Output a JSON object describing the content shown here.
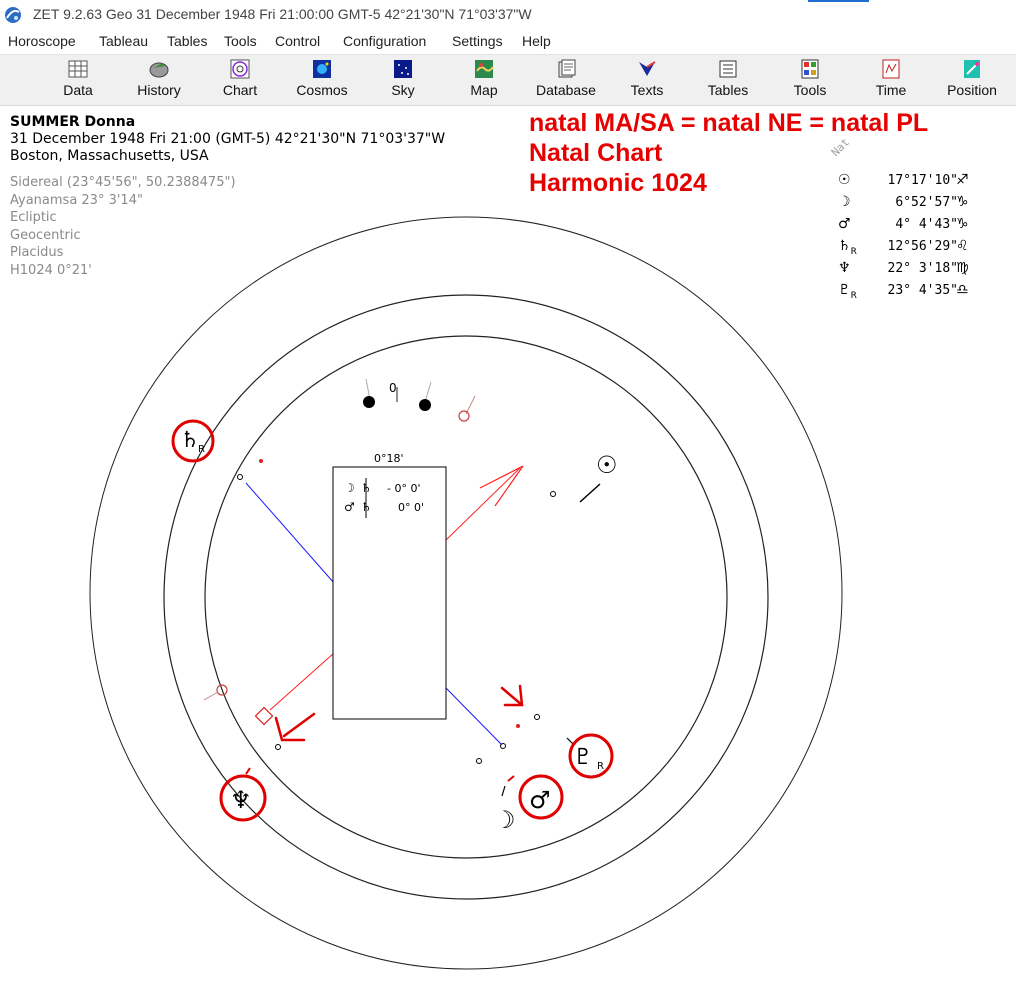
{
  "window": {
    "title": "ZET 9.2.63 Geo   31 December 1948  Fri  21:00:00 GMT-5 42°21'30\"N  71°03'37\"W"
  },
  "menu": [
    "Horoscope",
    "Tableau",
    "Tables",
    "Tools",
    "Control",
    "Configuration",
    "Settings",
    "Help"
  ],
  "toolbar": [
    {
      "label": "Data",
      "icon": "data-grid-icon"
    },
    {
      "label": "History",
      "icon": "history-icon"
    },
    {
      "label": "Chart",
      "icon": "chart-wheel-icon"
    },
    {
      "label": "Cosmos",
      "icon": "cosmos-icon"
    },
    {
      "label": "Sky",
      "icon": "sky-stars-icon"
    },
    {
      "label": "Map",
      "icon": "map-icon"
    },
    {
      "label": "Database",
      "icon": "database-icon"
    },
    {
      "label": "Texts",
      "icon": "texts-icon"
    },
    {
      "label": "Tables",
      "icon": "tables-icon"
    },
    {
      "label": "Tools",
      "icon": "tools-icon"
    },
    {
      "label": "Time",
      "icon": "time-icon"
    },
    {
      "label": "Position",
      "icon": "position-icon"
    }
  ],
  "person": {
    "name": "SUMMER Donna",
    "datetime": "31 December 1948  Fri  21:00 (GMT-5) 42°21'30\"N  71°03'37\"W",
    "place": "Boston, Massachusetts, USA"
  },
  "settings": [
    "Sidereal (23°45'56\", 50.2388475\")",
    "Ayanamsa 23° 3'14\"",
    "Ecliptic",
    "Geocentric",
    "Placidus",
    "H1024   0°21'"
  ],
  "notes": [
    "natal MA/SA = natal NE = natal PL",
    "Natal Chart",
    "Harmonic 1024"
  ],
  "positions": {
    "header": "Nat",
    "rows": [
      {
        "glyph": "☉",
        "retro": "",
        "value": "17°17'10\"",
        "sign": "♐"
      },
      {
        "glyph": "☽",
        "retro": "",
        "value": "6°52'57\"",
        "sign": "♑"
      },
      {
        "glyph": "♂",
        "retro": "",
        "value": "4° 4'43\"",
        "sign": "♑"
      },
      {
        "glyph": "♄",
        "retro": "R",
        "value": "12°56'29\"",
        "sign": "♌"
      },
      {
        "glyph": "♆",
        "retro": "",
        "value": "22° 3'18\"",
        "sign": "♍"
      },
      {
        "glyph": "♇",
        "retro": "R",
        "value": "23° 4'35\"",
        "sign": "♎"
      }
    ]
  },
  "wheel": {
    "top_label": "0",
    "orb_box": {
      "title": "0°18'",
      "rows": [
        {
          "a": "☽",
          "b": "♄",
          "value": "- 0° 0'"
        },
        {
          "a": "♂",
          "b": "♄",
          "value": "0° 0'"
        }
      ]
    },
    "planets": [
      {
        "glyph": "♄",
        "retro": "R",
        "circled": true
      },
      {
        "glyph": "☉",
        "retro": "",
        "circled": false
      },
      {
        "glyph": "♇",
        "retro": "R",
        "circled": true
      },
      {
        "glyph": "♂",
        "retro": "",
        "circled": true
      },
      {
        "glyph": "☽",
        "retro": "",
        "circled": false
      },
      {
        "glyph": "♆",
        "retro": "",
        "circled": true
      }
    ]
  },
  "colors": {
    "annotation_red": "#e60000",
    "aspect_blue": "#1a1aff",
    "aspect_red": "#ff2020",
    "meta_gray": "#8a8a8a"
  }
}
